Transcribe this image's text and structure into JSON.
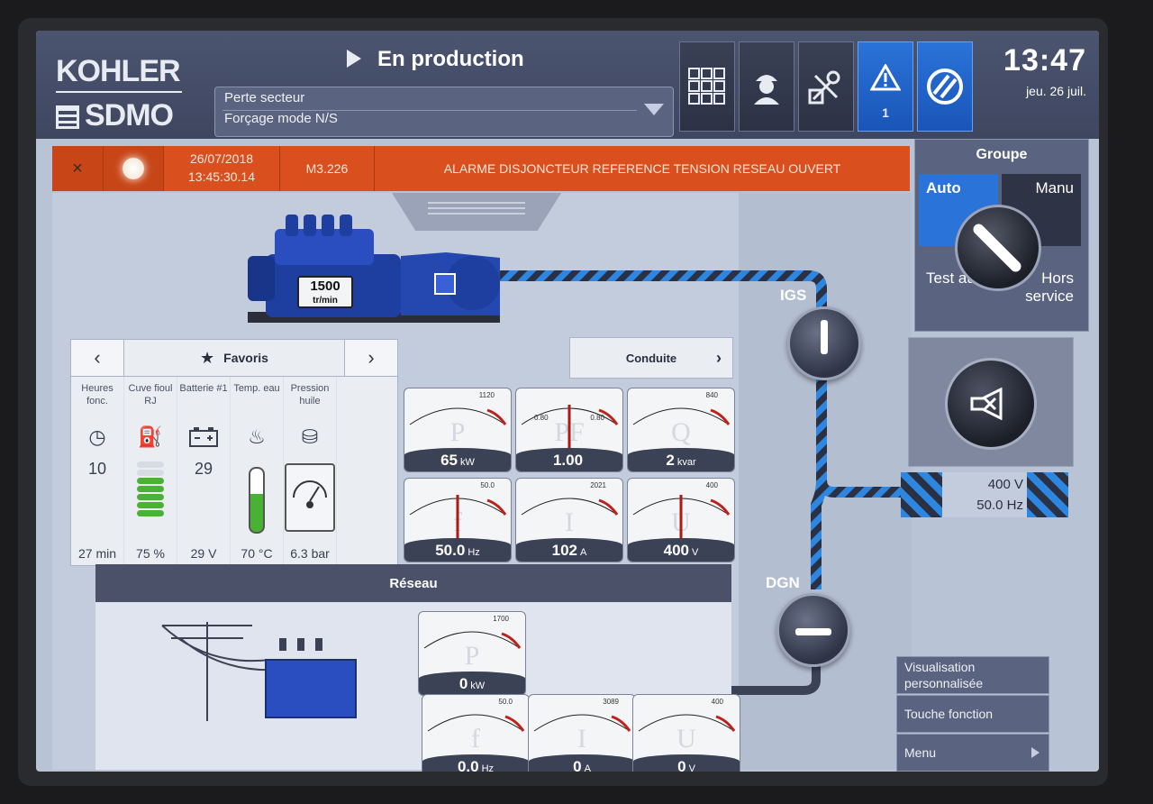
{
  "header": {
    "brand_top": "KOHLER",
    "brand_bottom": "SDMO",
    "status": "En production",
    "mode_line1": "Perte secteur",
    "mode_line2": "Forçage mode N/S",
    "alert_count": "1",
    "time": "13:47",
    "date": "jeu. 26 juil."
  },
  "toolbar": {
    "icons": [
      "grid-apps-icon",
      "operator-icon",
      "maintenance-icon",
      "warning-icon",
      "no-entry-icon"
    ]
  },
  "alarm": {
    "close_label": "×",
    "date": "26/07/2018",
    "time": "13:45:30.14",
    "code": "M3.226",
    "message": "ALARME DISJONCTEUR REFERENCE TENSION RESEAU OUVERT"
  },
  "genset": {
    "rpm": "1500",
    "rpm_unit": "tr/min"
  },
  "favorites": {
    "title": "Favoris",
    "items": [
      {
        "label": "Heures fonc.",
        "value": "10",
        "unit_value": "27",
        "unit": "min"
      },
      {
        "label": "Cuve fioul RJ",
        "value": "",
        "unit_value": "75",
        "unit": "%",
        "level": 0.75
      },
      {
        "label": "Batterie #1",
        "value": "29",
        "unit_value": "29",
        "unit": "V"
      },
      {
        "label": "Temp. eau",
        "value": "",
        "unit_value": "70",
        "unit": "°C",
        "level": 0.6
      },
      {
        "label": "Pression huile",
        "value": "",
        "unit_value": "6.3",
        "unit": "bar"
      }
    ]
  },
  "conduite": {
    "label": "Conduite"
  },
  "gen_meters": [
    {
      "letter": "P",
      "value": "65",
      "unit": "kW",
      "max": "1120",
      "needle": 0.06
    },
    {
      "letter": "PF",
      "value": "1.00",
      "unit": "",
      "left": "0.80",
      "right": "0.80",
      "needle": 0.5
    },
    {
      "letter": "Q",
      "value": "2",
      "unit": "kvar",
      "max": "840",
      "needle": 0.1
    },
    {
      "letter": "f",
      "value": "50.0",
      "unit": "Hz",
      "max": "50.0",
      "needle": 0.5
    },
    {
      "letter": "I",
      "value": "102",
      "unit": "A",
      "max": "2021",
      "needle": 0.07
    },
    {
      "letter": "U",
      "value": "400",
      "unit": "V",
      "max": "400",
      "needle": 0.5
    }
  ],
  "reseau": {
    "title": "Réseau",
    "meters": [
      {
        "letter": "P",
        "value": "0",
        "unit": "kW",
        "max": "1700",
        "needle": 0.0
      },
      {
        "letter": "f",
        "value": "0.0",
        "unit": "Hz",
        "max": "50.0",
        "needle": 0.0
      },
      {
        "letter": "I",
        "value": "0",
        "unit": "A",
        "max": "3089",
        "needle": 0.0
      },
      {
        "letter": "U",
        "value": "0",
        "unit": "V",
        "max": "400",
        "needle": 0.0
      }
    ]
  },
  "breakers": {
    "igs": "IGS",
    "dgn": "DGN"
  },
  "groupe": {
    "title": "Groupe",
    "auto": "Auto",
    "manu": "Manu",
    "test_auto": "Test auto",
    "hors_service": "Hors service"
  },
  "bus": {
    "voltage": "400 V",
    "frequency": "50.0 Hz"
  },
  "menu": {
    "visualisation": "Visualisation personnalisée",
    "touche": "Touche fonction",
    "menu": "Menu"
  },
  "colors": {
    "accent": "#2a73d8",
    "alarm": "#d9501e",
    "ok_green": "#49b234"
  }
}
